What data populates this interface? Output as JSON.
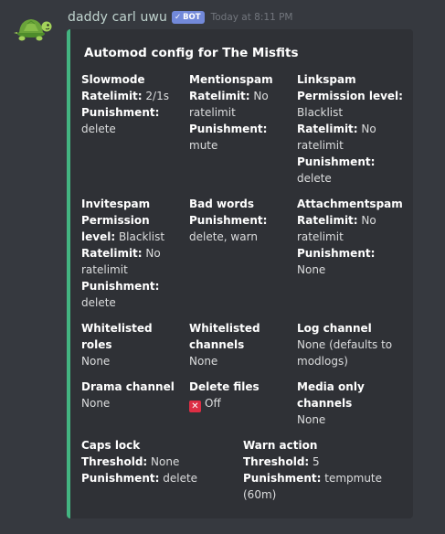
{
  "message": {
    "username": "daddy carl uwu",
    "bot_badge": "BOT",
    "timestamp": "Today at 8:11 PM"
  },
  "embed": {
    "accent_color": "#43b581",
    "title": "Automod config for The Misfits",
    "fields": {
      "slowmode": {
        "name": "Slowmode",
        "ratelimit_key": "Ratelimit:",
        "ratelimit_val": "2/1s",
        "punishment_key": "Punishment:",
        "punishment_val": "delete"
      },
      "mentionspam": {
        "name": "Mentionspam",
        "ratelimit_key": "Ratelimit:",
        "ratelimit_val": "No ratelimit",
        "punishment_key": "Punishment:",
        "punishment_val": "mute"
      },
      "linkspam": {
        "name": "Linkspam",
        "permission_key": "Permission level:",
        "permission_val": "Blacklist",
        "ratelimit_key": "Ratelimit:",
        "ratelimit_val": "No ratelimit",
        "punishment_key": "Punishment:",
        "punishment_val": "delete"
      },
      "invitespam": {
        "name": "Invitespam",
        "permission_key": "Permission level:",
        "permission_val": "Blacklist",
        "ratelimit_key": "Ratelimit:",
        "ratelimit_val": "No ratelimit",
        "punishment_key": "Punishment:",
        "punishment_val": "delete"
      },
      "bad_words": {
        "name": "Bad words",
        "punishment_key": "Punishment:",
        "punishment_val": "delete, warn"
      },
      "attachmentspam": {
        "name": "Attachmentspam",
        "ratelimit_key": "Ratelimit:",
        "ratelimit_val": "No ratelimit",
        "punishment_key": "Punishment:",
        "punishment_val": "None"
      },
      "whitelisted_roles": {
        "name": "Whitelisted roles",
        "value": "None"
      },
      "whitelisted_channels": {
        "name": "Whitelisted channels",
        "value": "None"
      },
      "log_channel": {
        "name": "Log channel",
        "value": "None (defaults to modlogs)"
      },
      "drama_channel": {
        "name": "Drama channel",
        "value": "None"
      },
      "delete_files": {
        "name": "Delete files",
        "value": "Off",
        "icon": "cross-mark-icon"
      },
      "media_only": {
        "name": "Media only channels",
        "value": "None"
      },
      "caps_lock": {
        "name": "Caps lock",
        "threshold_key": "Threshold:",
        "threshold_val": "None",
        "punishment_key": "Punishment:",
        "punishment_val": "delete"
      },
      "warn_action": {
        "name": "Warn action",
        "threshold_key": "Threshold:",
        "threshold_val": "5",
        "punishment_key": "Punishment:",
        "punishment_val": "tempmute (60m)"
      }
    }
  }
}
